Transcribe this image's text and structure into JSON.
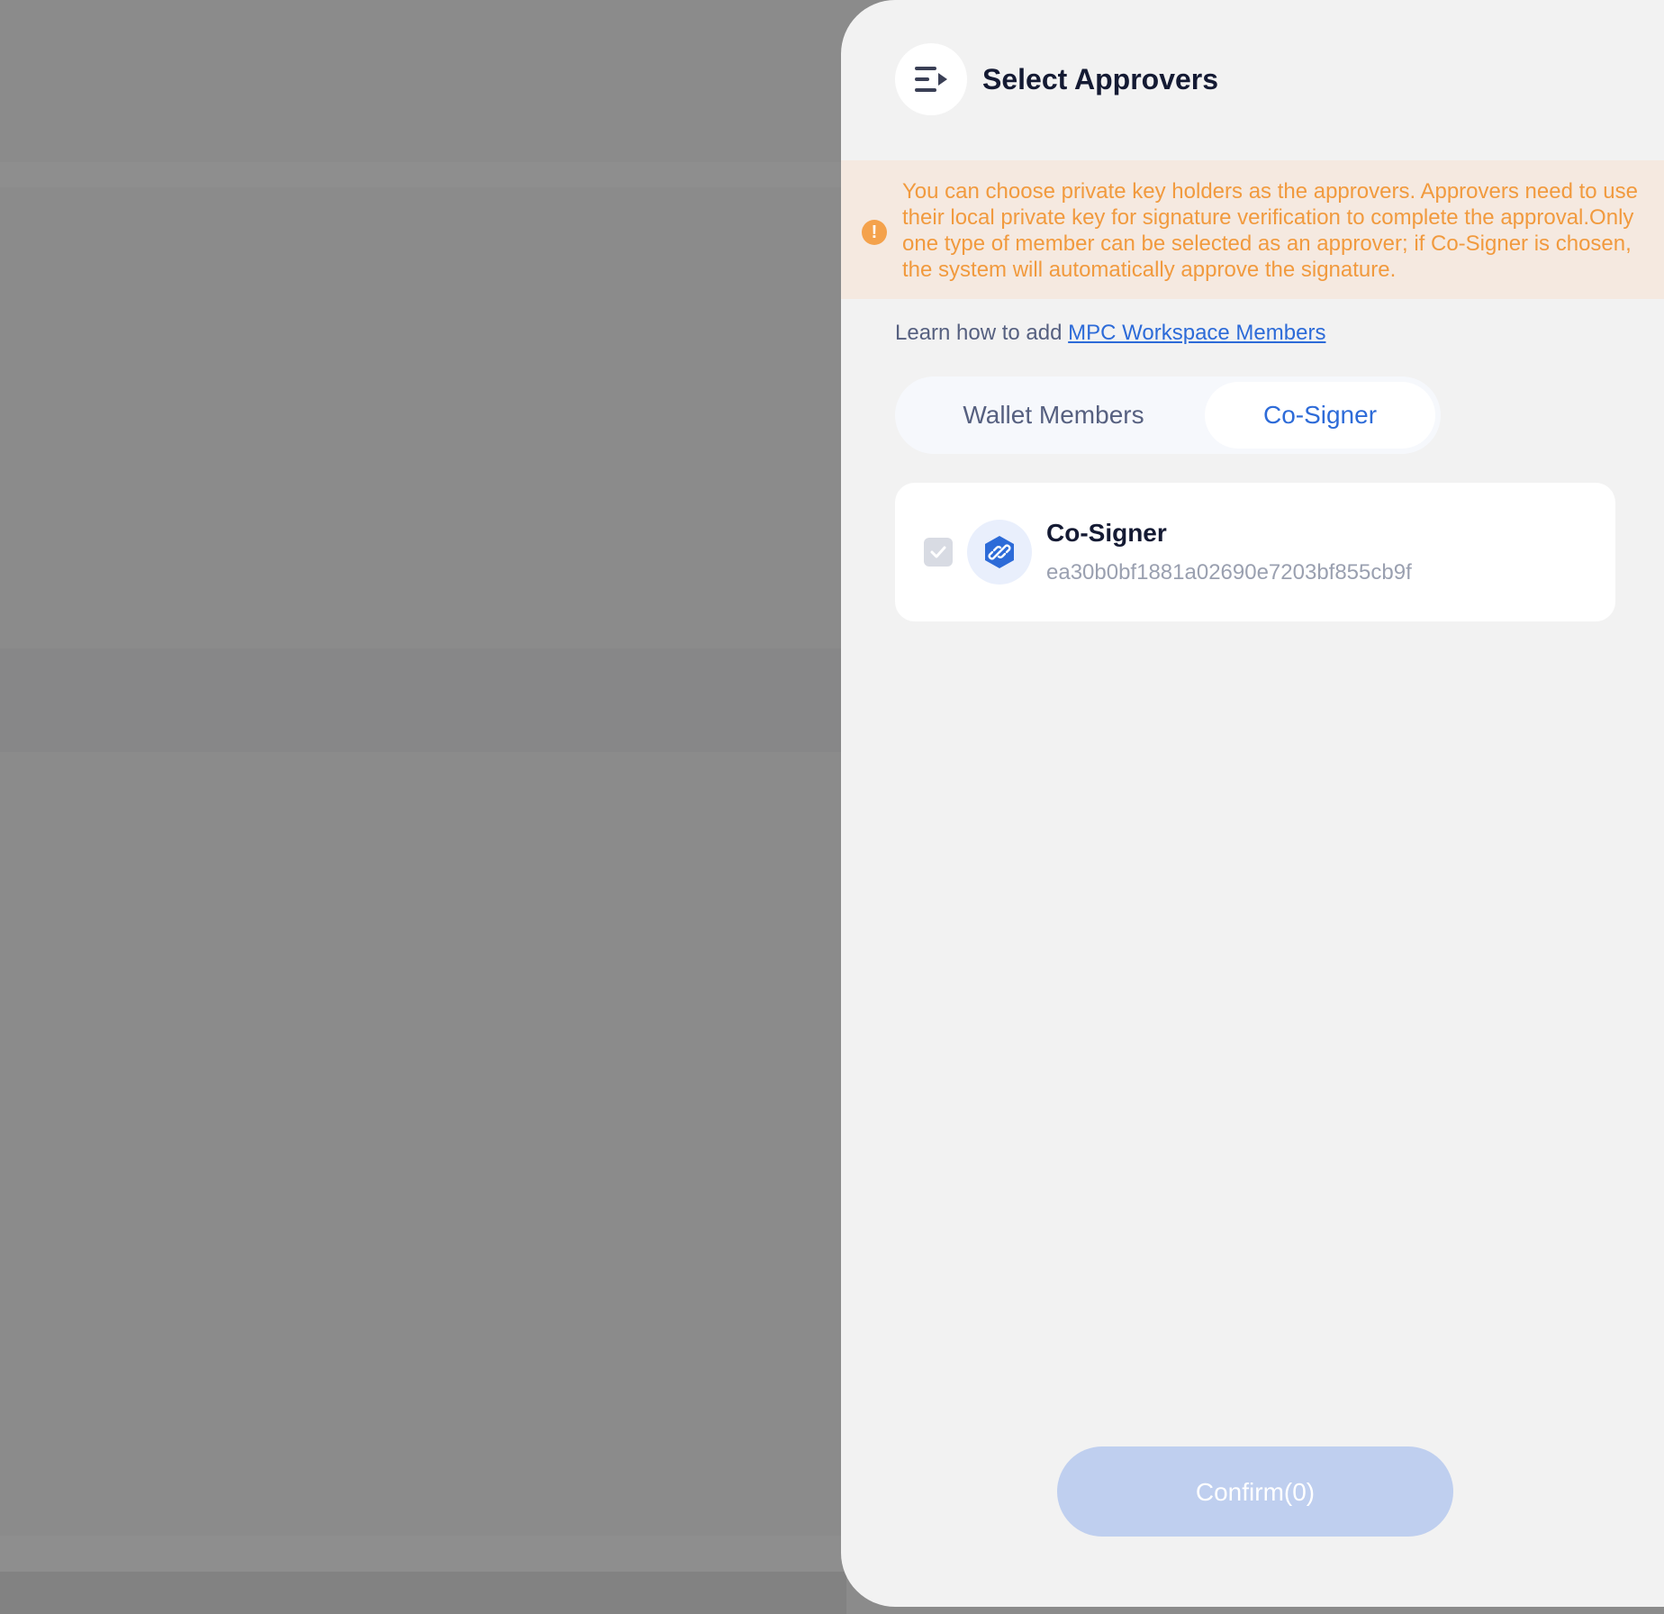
{
  "drawer": {
    "title": "Select Approvers",
    "alert_text": "You can choose private key holders as the approvers. Approvers need to use their local private key for signature verification to complete the approval.Only one type of member can be selected as an approver; if Co-Signer is chosen, the system will automatically approve the signature.",
    "learn_prefix": "Learn how to add",
    "learn_link": "MPC Workspace Members"
  },
  "tabs": [
    {
      "label": "Wallet Members",
      "active": false
    },
    {
      "label": "Co-Signer",
      "active": true
    }
  ],
  "members": [
    {
      "name": "Co-Signer",
      "id": "ea30b0bf1881a02690e7203bf855cb9f",
      "checked": true,
      "disabled": true
    }
  ],
  "footer": {
    "confirm_label": "Confirm(0)"
  },
  "colors": {
    "accent": "#2d6bd8",
    "warning": "#f19a3e",
    "warning_bg": "#f5e9e0",
    "confirm_disabled": "#bfcfef",
    "overlay": "#8b8b8b"
  },
  "icons": {
    "collapse": "collapse-drawer-icon",
    "alert": "exclamation-icon",
    "check": "check-icon",
    "cosigner": "cosigner-link-icon"
  }
}
